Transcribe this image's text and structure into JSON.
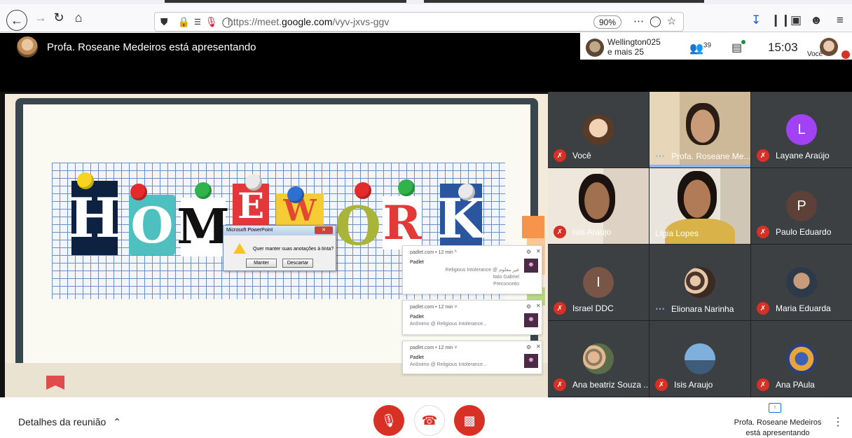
{
  "browser": {
    "url_prefix": "https://meet.",
    "url_domain": "google.com",
    "url_path": "/vyv-jxvs-ggv",
    "zoom": "90%",
    "icons": [
      "back-icon",
      "forward-icon",
      "reload-icon",
      "home-icon",
      "shield-icon",
      "lock-icon",
      "permissions-icon",
      "microphone-icon",
      "tracking-icon",
      "more-icon",
      "pocket-icon",
      "star-icon",
      "download-icon",
      "library-icon",
      "sidebar-icon",
      "account-icon",
      "menu-icon"
    ]
  },
  "meet_header": {
    "presenting_text": "Profa. Roseane Medeiros está apresentando",
    "participants_name": "Wellington025",
    "participants_more": "e mais 25",
    "people_count": "39",
    "time": "15:03",
    "you_label": "Você"
  },
  "slide": {
    "letters": [
      "H",
      "O",
      "M",
      "E",
      "W",
      "O",
      "R",
      "K"
    ],
    "dialog": {
      "title": "Microsoft PowerPoint",
      "message": "Quer manter suas anotações à tinta?",
      "keep_button": "Manter",
      "discard_button": "Descartar"
    }
  },
  "notifications": [
    {
      "header": "padlet.com • 12 min ^",
      "title": "Padlet",
      "right_lines": [
        "Religious Intolerance @ غير معلوم",
        "Italo Gabriel",
        "Preconceito"
      ],
      "body": ""
    },
    {
      "header": "padlet.com • 12 min ˅",
      "title": "Padlet",
      "right_lines": [],
      "body": "Anônimo @ Religious Intolerance..."
    },
    {
      "header": "padlet.com • 12 min ˅",
      "title": "Padlet",
      "right_lines": [],
      "body": "Anônimo @ Religious Intolerance..."
    }
  ],
  "participants": [
    {
      "name": "Você",
      "type": "photo-avatar",
      "muted": true
    },
    {
      "name": "Profa. Roseane Me...",
      "type": "video",
      "muted": false,
      "speaking": true
    },
    {
      "name": "Layane Araújo",
      "type": "letter",
      "letter": "L",
      "color": "#a142f4",
      "muted": true
    },
    {
      "name": "Isis Araujo",
      "type": "video",
      "muted": true
    },
    {
      "name": "Lígia Lopes",
      "type": "video",
      "muted": false
    },
    {
      "name": "Paulo Eduardo",
      "type": "letter",
      "letter": "P",
      "color": "#5d4037",
      "muted": true
    },
    {
      "name": "Israel DDC",
      "type": "letter",
      "letter": "I",
      "color": "#795548",
      "muted": true
    },
    {
      "name": "Elionara Narinha",
      "type": "photo-avatar",
      "muted": false,
      "speaking": true
    },
    {
      "name": "Maria Eduarda",
      "type": "photo-avatar",
      "muted": true
    },
    {
      "name": "Ana beatriz Souza ...",
      "type": "photo-avatar",
      "muted": true
    },
    {
      "name": "Isis Araujo",
      "type": "photo-avatar",
      "muted": true
    },
    {
      "name": "Ana PAula",
      "type": "photo-avatar",
      "muted": true
    }
  ],
  "bottom": {
    "details_label": "Detalhes da reunião",
    "presenting_line1": "Profa. Roseane Medeiros",
    "presenting_line2": "está apresentando"
  },
  "colors": {
    "meet_red": "#d93025",
    "meet_dark": "#202124",
    "tile_bg": "#3c4043",
    "accent_blue": "#8ab4f8"
  }
}
